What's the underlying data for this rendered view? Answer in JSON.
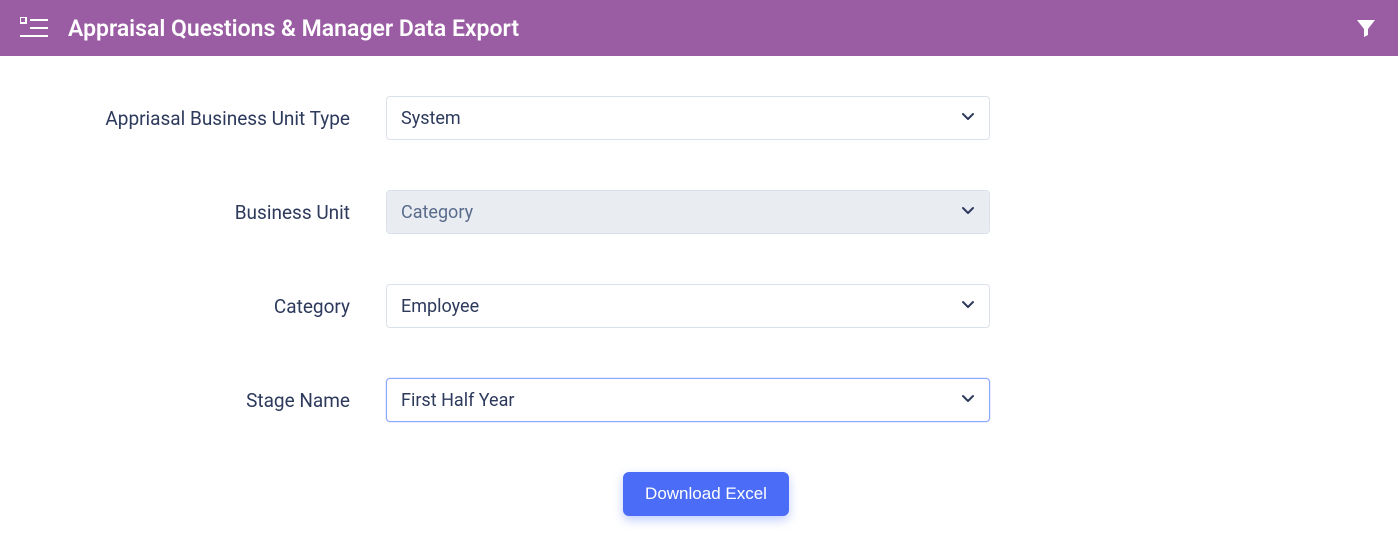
{
  "header": {
    "title": "Appraisal Questions & Manager Data Export"
  },
  "form": {
    "fields": [
      {
        "label": "Appriasal Business Unit Type",
        "value": "System",
        "disabled": false,
        "highlighted": false
      },
      {
        "label": "Business Unit",
        "value": "Category",
        "disabled": true,
        "highlighted": false
      },
      {
        "label": "Category",
        "value": "Employee",
        "disabled": false,
        "highlighted": false
      },
      {
        "label": "Stage Name",
        "value": "First Half Year",
        "disabled": false,
        "highlighted": true
      }
    ]
  },
  "actions": {
    "download_label": "Download Excel"
  }
}
